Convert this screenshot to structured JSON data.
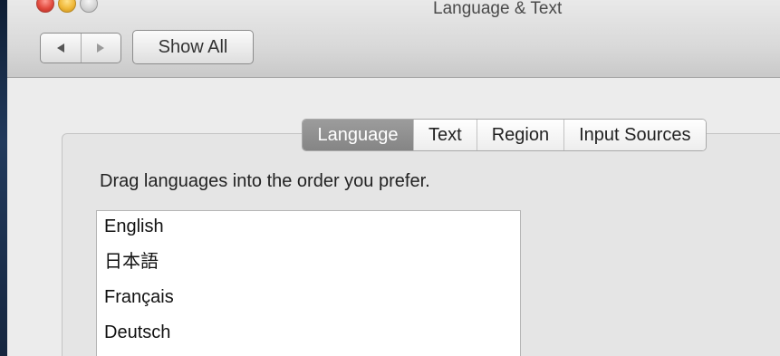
{
  "window": {
    "title": "Language & Text"
  },
  "toolbar": {
    "back_icon": "left-triangle",
    "forward_icon": "right-triangle",
    "show_all_label": "Show All"
  },
  "tabs": [
    {
      "label": "Language",
      "active": true
    },
    {
      "label": "Text",
      "active": false
    },
    {
      "label": "Region",
      "active": false
    },
    {
      "label": "Input Sources",
      "active": false
    }
  ],
  "language_pane": {
    "instruction": "Drag languages into the order you prefer.",
    "languages": [
      "English",
      "日本語",
      "Français",
      "Deutsch"
    ]
  },
  "colors": {
    "active_tab": "#8f8f8f",
    "close_button": "#e24b3f",
    "minimize_button": "#f0b93a",
    "zoom_button": "#d3d3d3"
  }
}
